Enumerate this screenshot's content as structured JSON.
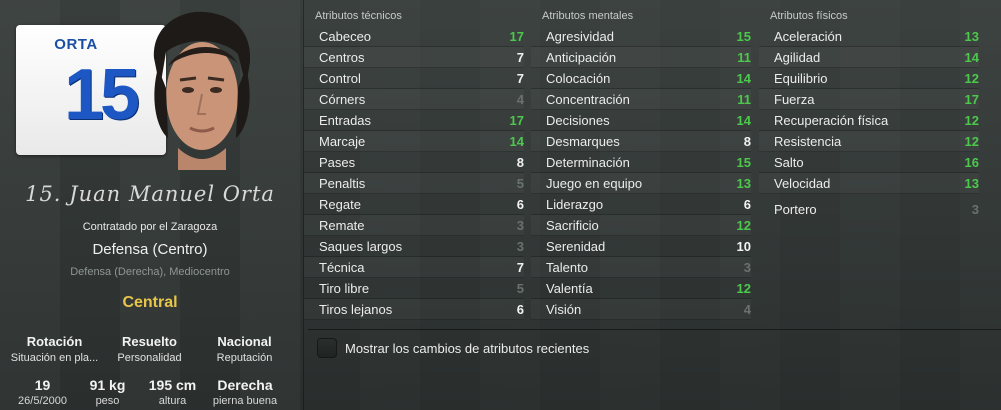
{
  "player": {
    "shirt_name": "ORTA",
    "shirt_number": "15",
    "signature": "15. Juan Manuel Orta",
    "contract": "Contratado por el Zaragoza",
    "position_main": "Defensa (Centro)",
    "position_alt": "Defensa (Derecha), Mediocentro",
    "role": "Central"
  },
  "info_top": [
    {
      "value": "Rotación",
      "label": "Situación en pla..."
    },
    {
      "value": "Resuelto",
      "label": "Personalidad"
    },
    {
      "value": "Nacional",
      "label": "Reputación"
    }
  ],
  "info_bottom": [
    {
      "value": "19",
      "label": "26/5/2000"
    },
    {
      "value": "91 kg",
      "label": "peso"
    },
    {
      "value": "195 cm",
      "label": "altura"
    },
    {
      "value": "Derecha",
      "label": "pierna buena"
    }
  ],
  "attributes": {
    "technical": {
      "header": "Atributos técnicos",
      "items": [
        {
          "name": "Cabeceo",
          "value": "17",
          "tone": "green"
        },
        {
          "name": "Centros",
          "value": "7",
          "tone": "white"
        },
        {
          "name": "Control",
          "value": "7",
          "tone": "white"
        },
        {
          "name": "Córners",
          "value": "4",
          "tone": "grey"
        },
        {
          "name": "Entradas",
          "value": "17",
          "tone": "green"
        },
        {
          "name": "Marcaje",
          "value": "14",
          "tone": "green"
        },
        {
          "name": "Pases",
          "value": "8",
          "tone": "white"
        },
        {
          "name": "Penaltis",
          "value": "5",
          "tone": "grey"
        },
        {
          "name": "Regate",
          "value": "6",
          "tone": "white"
        },
        {
          "name": "Remate",
          "value": "3",
          "tone": "grey"
        },
        {
          "name": "Saques largos",
          "value": "3",
          "tone": "grey"
        },
        {
          "name": "Técnica",
          "value": "7",
          "tone": "white"
        },
        {
          "name": "Tiro libre",
          "value": "5",
          "tone": "grey"
        },
        {
          "name": "Tiros lejanos",
          "value": "6",
          "tone": "white"
        }
      ]
    },
    "mental": {
      "header": "Atributos mentales",
      "items": [
        {
          "name": "Agresividad",
          "value": "15",
          "tone": "green"
        },
        {
          "name": "Anticipación",
          "value": "11",
          "tone": "green"
        },
        {
          "name": "Colocación",
          "value": "14",
          "tone": "green"
        },
        {
          "name": "Concentración",
          "value": "11",
          "tone": "green"
        },
        {
          "name": "Decisiones",
          "value": "14",
          "tone": "green"
        },
        {
          "name": "Desmarques",
          "value": "8",
          "tone": "white"
        },
        {
          "name": "Determinación",
          "value": "15",
          "tone": "green"
        },
        {
          "name": "Juego en equipo",
          "value": "13",
          "tone": "green"
        },
        {
          "name": "Liderazgo",
          "value": "6",
          "tone": "white"
        },
        {
          "name": "Sacrificio",
          "value": "12",
          "tone": "green"
        },
        {
          "name": "Serenidad",
          "value": "10",
          "tone": "white"
        },
        {
          "name": "Talento",
          "value": "3",
          "tone": "grey"
        },
        {
          "name": "Valentía",
          "value": "12",
          "tone": "green"
        },
        {
          "name": "Visión",
          "value": "4",
          "tone": "grey"
        }
      ]
    },
    "physical": {
      "header": "Atributos físicos",
      "items": [
        {
          "name": "Aceleración",
          "value": "13",
          "tone": "green"
        },
        {
          "name": "Agilidad",
          "value": "14",
          "tone": "green"
        },
        {
          "name": "Equilibrio",
          "value": "12",
          "tone": "green"
        },
        {
          "name": "Fuerza",
          "value": "17",
          "tone": "green"
        },
        {
          "name": "Recuperación física",
          "value": "12",
          "tone": "green"
        },
        {
          "name": "Resistencia",
          "value": "12",
          "tone": "green"
        },
        {
          "name": "Salto",
          "value": "16",
          "tone": "green"
        },
        {
          "name": "Velocidad",
          "value": "13",
          "tone": "green"
        }
      ],
      "portero": {
        "name": "Portero",
        "value": "3",
        "tone": "grey"
      }
    }
  },
  "checkbox_label": "Mostrar los cambios de atributos recientes",
  "colors": {
    "high_value": "#4cc94c",
    "mid_value": "#f2f2f2",
    "low_value": "#6a716e",
    "role_gold": "#e8c64a",
    "shirt_blue": "#1c57c4"
  }
}
